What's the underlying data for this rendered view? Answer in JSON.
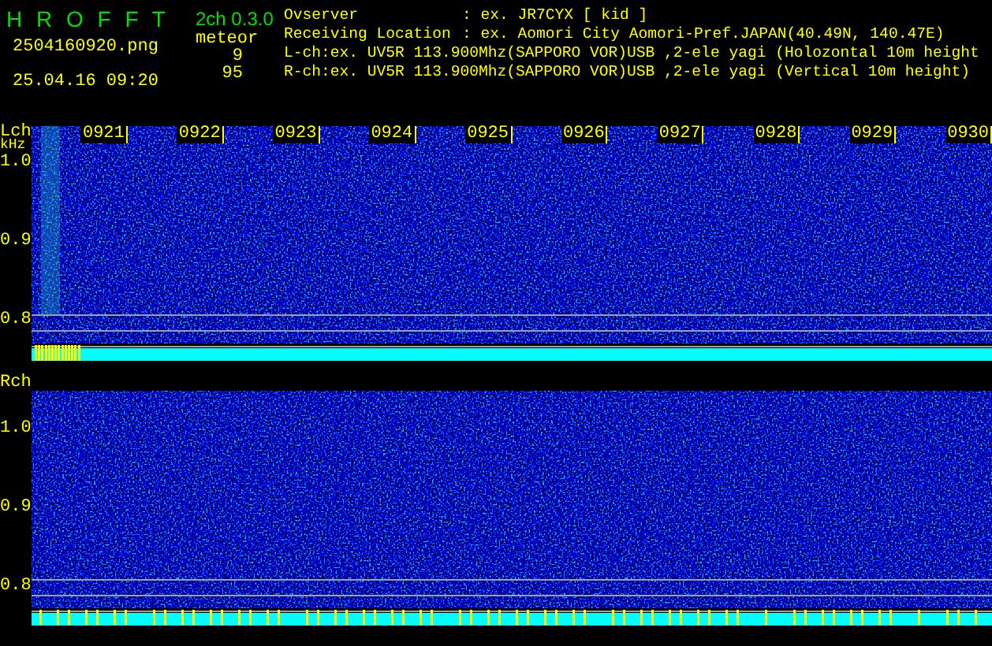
{
  "app": {
    "title": "H R O F F T",
    "version": "2ch 0.3.0",
    "filename": "2504160920.png",
    "datetime": "25.04.16 09:20",
    "meteor_label": "meteor",
    "counts": [
      "9",
      "95"
    ]
  },
  "info": [
    {
      "kind": "field",
      "label": "Ovserver",
      "value": ": ex. JR7CYX [ kid ]"
    },
    {
      "kind": "field",
      "label": "Receiving Location",
      "value": ": ex. Aomori City Aomori-Pref.JAPAN(40.49N, 140.47E)"
    },
    {
      "kind": "line",
      "text": "L-ch:ex. UV5R 113.900Mhz(SAPPORO VOR)USB ,2-ele yagi (Holozontal 10m height"
    },
    {
      "kind": "line",
      "text": "R-ch:ex. UV5R 113.900Mhz(SAPPORO VOR)USB ,2-ele yagi (Vertical 10m height)"
    }
  ],
  "channels": [
    {
      "label": "Lch",
      "unit": "kHz",
      "ticks": [
        "1.0",
        "0.9",
        "0.8"
      ],
      "time_labels": [
        "0921",
        "0922",
        "0923",
        "0924",
        "0925",
        "0926",
        "0927",
        "0928",
        "0929",
        "0930"
      ]
    },
    {
      "label": "Rch",
      "ticks": [
        "1.0",
        "0.9",
        "0.8"
      ]
    }
  ]
}
